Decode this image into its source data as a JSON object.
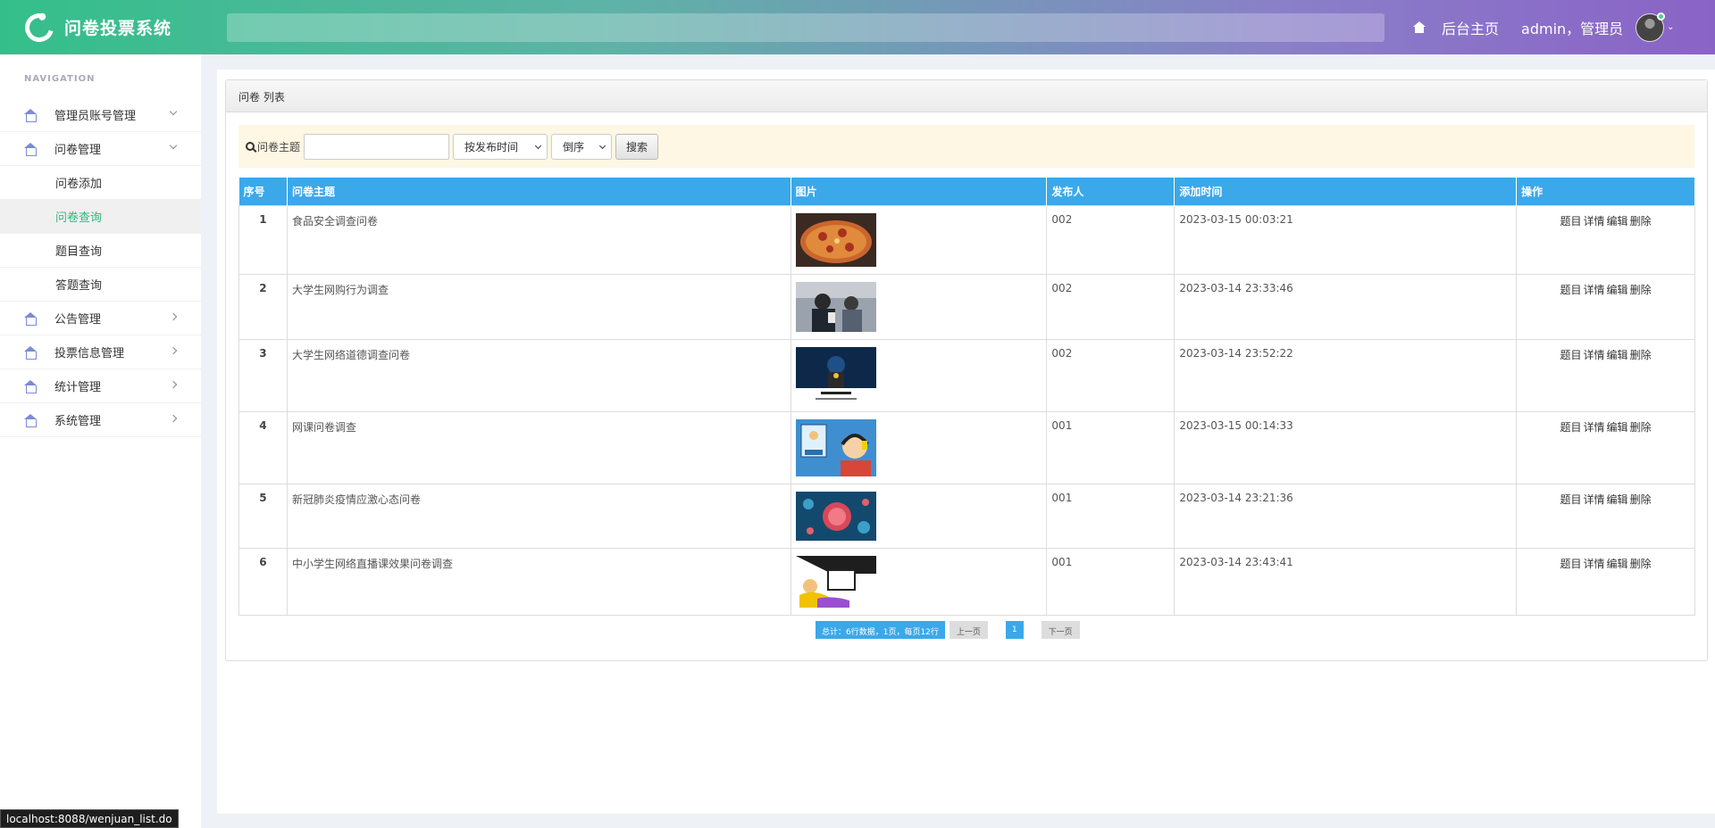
{
  "app": {
    "title": "问卷投票系统"
  },
  "header": {
    "home_label": "后台主页",
    "user_label": "admin，管理员"
  },
  "sidebar": {
    "nav_label": "NAVIGATION",
    "items": [
      {
        "label": "管理员账号管理"
      },
      {
        "label": "问卷管理"
      },
      {
        "label": "公告管理"
      },
      {
        "label": "投票信息管理"
      },
      {
        "label": "统计管理"
      },
      {
        "label": "系统管理"
      }
    ],
    "sub_items": [
      {
        "label": "问卷添加"
      },
      {
        "label": "问卷查询"
      },
      {
        "label": "题目查询"
      },
      {
        "label": "答题查询"
      }
    ]
  },
  "panel": {
    "title": "问卷 列表"
  },
  "search": {
    "label": "问卷主题",
    "value": "",
    "sort_field": "按发布时间",
    "sort_order": "倒序",
    "button": "搜索"
  },
  "table": {
    "headers": [
      "序号",
      "问卷主题",
      "图片",
      "发布人",
      "添加时间",
      "操作"
    ],
    "actions": [
      "题目",
      "详情",
      "编辑",
      "删除"
    ],
    "rows": [
      {
        "no": "1",
        "topic": "食品安全调查问卷",
        "publisher": "002",
        "time": "2023-03-15 00:03:21",
        "image": "pizza"
      },
      {
        "no": "2",
        "topic": "大学生网购行为调查",
        "publisher": "002",
        "time": "2023-03-14 23:33:46",
        "image": "students-with-phone"
      },
      {
        "no": "3",
        "topic": "大学生网络道德调查问卷",
        "publisher": "002",
        "time": "2023-03-14 23:52:22",
        "image": "network-ethics-poster"
      },
      {
        "no": "4",
        "topic": "网课问卷调查",
        "publisher": "001",
        "time": "2023-03-15 00:14:33",
        "image": "online-class-cartoon"
      },
      {
        "no": "5",
        "topic": "新冠肺炎疫情应激心态问卷",
        "publisher": "001",
        "time": "2023-03-14 23:21:36",
        "image": "virus"
      },
      {
        "no": "6",
        "topic": "中小学生网络直播课效果问卷调查",
        "publisher": "001",
        "time": "2023-03-14 23:43:41",
        "image": "live-class-cartoon"
      }
    ]
  },
  "pager": {
    "info": "总计：6行数据，1页，每页12行",
    "prev": "上一页",
    "current": "1",
    "next": "下一页"
  },
  "status_url": "localhost:8088/wenjuan_list.do",
  "colors": {
    "accent": "#3ba8ea",
    "sidebar_active": "#2fb880",
    "header_start": "#34bf8a",
    "header_end": "#8a63c7"
  }
}
